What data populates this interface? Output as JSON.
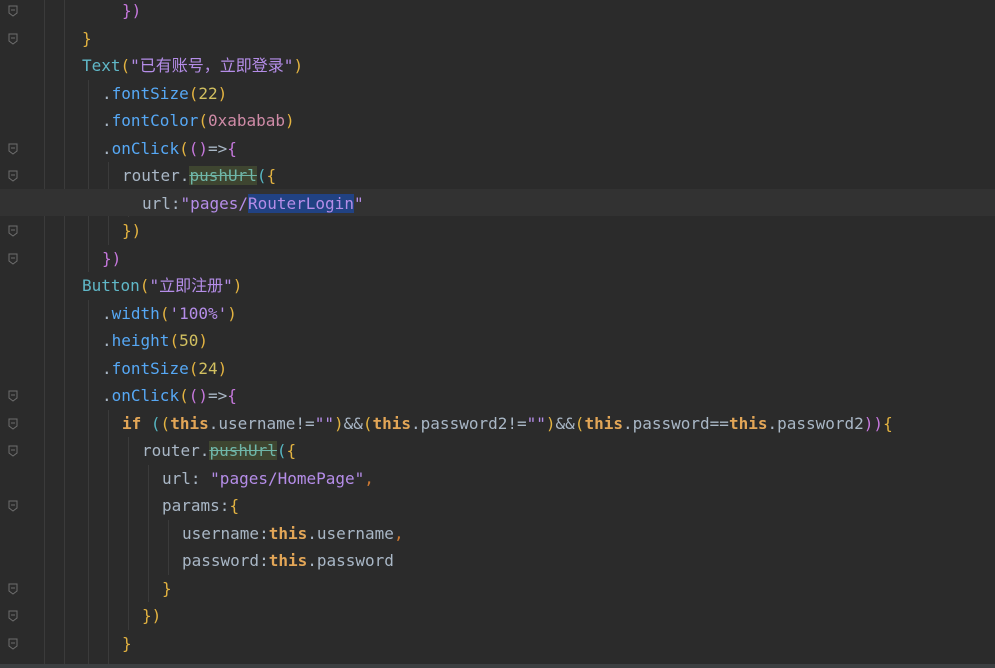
{
  "colors": {
    "background": "#2b2b2b",
    "current_line": "#323232",
    "selection": "#214283",
    "string": "#b58de8",
    "method": "#56a8f5",
    "keyword": "#e3a657"
  },
  "editor": {
    "lines": [
      {
        "tokens": [
          {
            "t": "})",
            "c": "t-br2"
          }
        ]
      },
      {
        "tokens": [
          {
            "t": "}",
            "c": "t-br1"
          }
        ]
      },
      {
        "tokens": [
          {
            "t": "Text",
            "c": "t-call"
          },
          {
            "t": "(",
            "c": "t-br1"
          },
          {
            "t": "\"已有账号，立即登录\"",
            "c": "t-str"
          },
          {
            "t": ")",
            "c": "t-br1"
          }
        ]
      },
      {
        "tokens": [
          {
            "t": ".",
            "c": "t-plain"
          },
          {
            "t": "fontSize",
            "c": "t-fn"
          },
          {
            "t": "(",
            "c": "t-br1"
          },
          {
            "t": "22",
            "c": "t-num"
          },
          {
            "t": ")",
            "c": "t-br1"
          }
        ]
      },
      {
        "tokens": [
          {
            "t": ".",
            "c": "t-plain"
          },
          {
            "t": "fontColor",
            "c": "t-fn"
          },
          {
            "t": "(",
            "c": "t-br1"
          },
          {
            "t": "0xababab",
            "c": "t-hex"
          },
          {
            "t": ")",
            "c": "t-br1"
          }
        ]
      },
      {
        "tokens": [
          {
            "t": ".",
            "c": "t-plain"
          },
          {
            "t": "onClick",
            "c": "t-fn"
          },
          {
            "t": "(",
            "c": "t-br1"
          },
          {
            "t": "()",
            "c": "t-br2"
          },
          {
            "t": "=>",
            "c": "t-plain"
          },
          {
            "t": "{",
            "c": "t-br2"
          }
        ]
      },
      {
        "tokens": [
          {
            "t": "router",
            "c": "t-plain"
          },
          {
            "t": ".",
            "c": "t-plain"
          },
          {
            "t": "pushUrl",
            "c": "t-dep"
          },
          {
            "t": "(",
            "c": "t-br3"
          },
          {
            "t": "{",
            "c": "t-br1"
          }
        ]
      },
      {
        "tokens": [
          {
            "t": "url",
            "c": "t-plain"
          },
          {
            "t": ":",
            "c": "t-plain"
          },
          {
            "t": "\"pages/",
            "c": "t-str"
          },
          {
            "t": "RouterLogin",
            "c": "t-str t-sel"
          },
          {
            "t": "\"",
            "c": "t-str"
          }
        ]
      },
      {
        "tokens": [
          {
            "t": "})",
            "c": "t-br1"
          }
        ]
      },
      {
        "tokens": [
          {
            "t": "})",
            "c": "t-br2"
          }
        ]
      },
      {
        "tokens": [
          {
            "t": "Button",
            "c": "t-call"
          },
          {
            "t": "(",
            "c": "t-br1"
          },
          {
            "t": "\"立即注册\"",
            "c": "t-str"
          },
          {
            "t": ")",
            "c": "t-br1"
          }
        ]
      },
      {
        "tokens": [
          {
            "t": ".",
            "c": "t-plain"
          },
          {
            "t": "width",
            "c": "t-fn"
          },
          {
            "t": "(",
            "c": "t-br1"
          },
          {
            "t": "'100%'",
            "c": "t-str"
          },
          {
            "t": ")",
            "c": "t-br1"
          }
        ]
      },
      {
        "tokens": [
          {
            "t": ".",
            "c": "t-plain"
          },
          {
            "t": "height",
            "c": "t-fn"
          },
          {
            "t": "(",
            "c": "t-br1"
          },
          {
            "t": "50",
            "c": "t-num"
          },
          {
            "t": ")",
            "c": "t-br1"
          }
        ]
      },
      {
        "tokens": [
          {
            "t": ".",
            "c": "t-plain"
          },
          {
            "t": "fontSize",
            "c": "t-fn"
          },
          {
            "t": "(",
            "c": "t-br1"
          },
          {
            "t": "24",
            "c": "t-num"
          },
          {
            "t": ")",
            "c": "t-br1"
          }
        ]
      },
      {
        "tokens": [
          {
            "t": ".",
            "c": "t-plain"
          },
          {
            "t": "onClick",
            "c": "t-fn"
          },
          {
            "t": "(",
            "c": "t-br1"
          },
          {
            "t": "()",
            "c": "t-br2"
          },
          {
            "t": "=>",
            "c": "t-plain"
          },
          {
            "t": "{",
            "c": "t-br2"
          }
        ]
      },
      {
        "tokens": [
          {
            "t": "if",
            "c": "t-kw"
          },
          {
            "t": " ",
            "c": "t-plain"
          },
          {
            "t": "(",
            "c": "t-br3"
          },
          {
            "t": "(",
            "c": "t-br1"
          },
          {
            "t": "this",
            "c": "t-kw"
          },
          {
            "t": ".username!=",
            "c": "t-plain"
          },
          {
            "t": "\"\"",
            "c": "t-str"
          },
          {
            "t": ")",
            "c": "t-br1"
          },
          {
            "t": "&&",
            "c": "t-plain"
          },
          {
            "t": "(",
            "c": "t-br1"
          },
          {
            "t": "this",
            "c": "t-kw"
          },
          {
            "t": ".password2!=",
            "c": "t-plain"
          },
          {
            "t": "\"\"",
            "c": "t-str"
          },
          {
            "t": ")",
            "c": "t-br1"
          },
          {
            "t": "&&",
            "c": "t-plain"
          },
          {
            "t": "(",
            "c": "t-br1"
          },
          {
            "t": "this",
            "c": "t-kw"
          },
          {
            "t": ".password==",
            "c": "t-plain"
          },
          {
            "t": "this",
            "c": "t-kw"
          },
          {
            "t": ".password2",
            "c": "t-plain"
          },
          {
            "t": "))",
            "c": "t-br2"
          },
          {
            "t": "{",
            "c": "t-br1"
          }
        ]
      },
      {
        "tokens": [
          {
            "t": "router",
            "c": "t-plain"
          },
          {
            "t": ".",
            "c": "t-plain"
          },
          {
            "t": "pushUrl",
            "c": "t-dep"
          },
          {
            "t": "(",
            "c": "t-br3"
          },
          {
            "t": "{",
            "c": "t-br1"
          }
        ]
      },
      {
        "tokens": [
          {
            "t": "url: ",
            "c": "t-plain"
          },
          {
            "t": "\"pages/HomePage\"",
            "c": "t-str"
          },
          {
            "t": ",",
            "c": "t-punct"
          }
        ]
      },
      {
        "tokens": [
          {
            "t": "params",
            "c": "t-plain"
          },
          {
            "t": ":",
            "c": "t-plain"
          },
          {
            "t": "{",
            "c": "t-br1"
          }
        ]
      },
      {
        "tokens": [
          {
            "t": "username",
            "c": "t-plain"
          },
          {
            "t": ":",
            "c": "t-plain"
          },
          {
            "t": "this",
            "c": "t-kw"
          },
          {
            "t": ".username",
            "c": "t-plain"
          },
          {
            "t": ",",
            "c": "t-punct"
          }
        ]
      },
      {
        "tokens": [
          {
            "t": "password",
            "c": "t-plain"
          },
          {
            "t": ":",
            "c": "t-plain"
          },
          {
            "t": "this",
            "c": "t-kw"
          },
          {
            "t": ".password",
            "c": "t-plain"
          }
        ]
      },
      {
        "tokens": [
          {
            "t": "}",
            "c": "t-br1"
          }
        ]
      },
      {
        "tokens": [
          {
            "t": "})",
            "c": "t-br1"
          }
        ]
      },
      {
        "tokens": [
          {
            "t": "}",
            "c": "t-br1"
          }
        ]
      },
      {
        "tokens": [
          {
            "t": "",
            "c": "t-plain"
          }
        ]
      }
    ]
  }
}
